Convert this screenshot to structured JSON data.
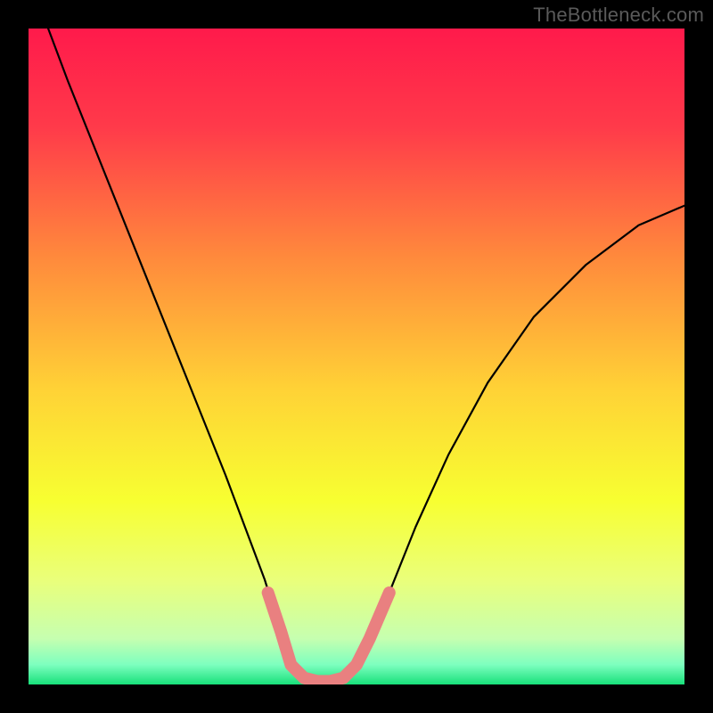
{
  "watermark": "TheBottleneck.com",
  "chart_data": {
    "type": "line",
    "title": "",
    "xlabel": "",
    "ylabel": "",
    "xlim": [
      0,
      100
    ],
    "ylim": [
      0,
      100
    ],
    "grid": false,
    "legend": false,
    "gradient_stops": [
      {
        "offset": 0.0,
        "color": "#ff1a4b"
      },
      {
        "offset": 0.15,
        "color": "#ff3a4a"
      },
      {
        "offset": 0.35,
        "color": "#ff8a3c"
      },
      {
        "offset": 0.55,
        "color": "#ffd236"
      },
      {
        "offset": 0.72,
        "color": "#f7ff31"
      },
      {
        "offset": 0.84,
        "color": "#eaff7a"
      },
      {
        "offset": 0.93,
        "color": "#c6ffb0"
      },
      {
        "offset": 0.97,
        "color": "#7dffbf"
      },
      {
        "offset": 1.0,
        "color": "#18e07a"
      }
    ],
    "series": [
      {
        "name": "curve",
        "stroke": "#000000",
        "stroke_width": 2.2,
        "points": [
          {
            "x": 3.0,
            "y": 100.0
          },
          {
            "x": 6.0,
            "y": 92.0
          },
          {
            "x": 10.0,
            "y": 82.0
          },
          {
            "x": 14.0,
            "y": 72.0
          },
          {
            "x": 18.0,
            "y": 62.0
          },
          {
            "x": 22.0,
            "y": 52.0
          },
          {
            "x": 26.0,
            "y": 42.0
          },
          {
            "x": 30.0,
            "y": 32.0
          },
          {
            "x": 33.0,
            "y": 24.0
          },
          {
            "x": 36.0,
            "y": 16.0
          },
          {
            "x": 38.5,
            "y": 8.0
          },
          {
            "x": 40.0,
            "y": 3.0
          },
          {
            "x": 42.0,
            "y": 1.0
          },
          {
            "x": 44.0,
            "y": 0.5
          },
          {
            "x": 46.0,
            "y": 0.5
          },
          {
            "x": 48.0,
            "y": 1.0
          },
          {
            "x": 50.0,
            "y": 3.0
          },
          {
            "x": 52.0,
            "y": 7.0
          },
          {
            "x": 55.0,
            "y": 14.0
          },
          {
            "x": 59.0,
            "y": 24.0
          },
          {
            "x": 64.0,
            "y": 35.0
          },
          {
            "x": 70.0,
            "y": 46.0
          },
          {
            "x": 77.0,
            "y": 56.0
          },
          {
            "x": 85.0,
            "y": 64.0
          },
          {
            "x": 93.0,
            "y": 70.0
          },
          {
            "x": 100.0,
            "y": 73.0
          }
        ]
      },
      {
        "name": "highlighted-band",
        "stroke": "#e98080",
        "stroke_width": 14,
        "linecap": "round",
        "points": [
          {
            "x": 36.5,
            "y": 14.0
          },
          {
            "x": 38.5,
            "y": 8.0
          },
          {
            "x": 40.0,
            "y": 3.0
          },
          {
            "x": 42.0,
            "y": 1.0
          },
          {
            "x": 44.0,
            "y": 0.5
          },
          {
            "x": 46.0,
            "y": 0.5
          },
          {
            "x": 48.0,
            "y": 1.0
          },
          {
            "x": 50.0,
            "y": 3.0
          },
          {
            "x": 52.0,
            "y": 7.0
          },
          {
            "x": 55.0,
            "y": 14.0
          }
        ]
      }
    ]
  }
}
